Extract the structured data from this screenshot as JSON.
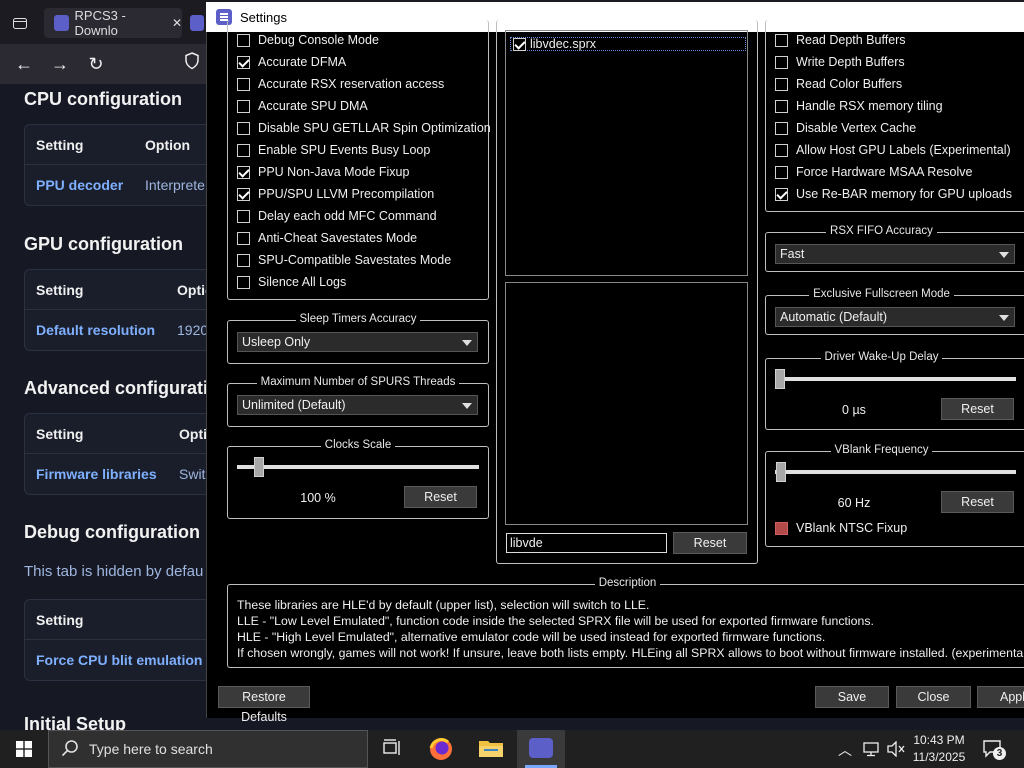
{
  "browser": {
    "tab_title": "RPCS3 - Downlo",
    "close_glyph": "✕"
  },
  "page": {
    "cpu_title": "CPU configuration",
    "cpu_header_setting": "Setting",
    "cpu_header_option": "Option",
    "cpu_row_setting": "PPU decoder",
    "cpu_row_option": "Interprete",
    "gpu_title": "GPU configuration",
    "gpu_header_setting": "Setting",
    "gpu_header_option": "Optio",
    "gpu_row_setting": "Default resolution",
    "gpu_row_option": "1920",
    "adv_title": "Advanced configurati",
    "adv_header_setting": "Setting",
    "adv_header_option": "Optio",
    "adv_row_setting": "Firmware libraries",
    "adv_row_option": "Swit",
    "debug_title": "Debug configuration",
    "debug_hidden": "This tab is hidden by defau",
    "debug_header_setting": "Setting",
    "debug_row_setting": "Force CPU blit emulation",
    "initial_title": "Initial Setup"
  },
  "settings": {
    "title": "Settings",
    "left_checkboxes": [
      {
        "label": "Debug Console Mode",
        "checked": false
      },
      {
        "label": "Accurate DFMA",
        "checked": true
      },
      {
        "label": "Accurate RSX reservation access",
        "checked": false
      },
      {
        "label": "Accurate SPU DMA",
        "checked": false
      },
      {
        "label": "Disable SPU GETLLAR Spin Optimization",
        "checked": false
      },
      {
        "label": "Enable SPU Events Busy Loop",
        "checked": false
      },
      {
        "label": "PPU Non-Java Mode Fixup",
        "checked": true
      },
      {
        "label": "PPU/SPU LLVM Precompilation",
        "checked": true
      },
      {
        "label": "Delay each odd MFC Command",
        "checked": false
      },
      {
        "label": "Anti-Cheat Savestates Mode",
        "checked": false
      },
      {
        "label": "SPU-Compatible Savestates Mode",
        "checked": false
      },
      {
        "label": "Silence All Logs",
        "checked": false
      }
    ],
    "sleep_timers": {
      "title": "Sleep Timers Accuracy",
      "value": "Usleep Only"
    },
    "spurs": {
      "title": "Maximum Number of SPURS Threads",
      "value": "Unlimited (Default)"
    },
    "clocks": {
      "title": "Clocks Scale",
      "value": "100 %",
      "level": 0.05,
      "reset": "Reset"
    },
    "libs": {
      "item": "libvdec.sprx",
      "item_checked": true,
      "filter": "libvde",
      "reset": "Reset"
    },
    "right_checkboxes": [
      {
        "label": "Read Depth Buffers",
        "checked": false
      },
      {
        "label": "Write Depth Buffers",
        "checked": false
      },
      {
        "label": "Read Color Buffers",
        "checked": false
      },
      {
        "label": "Handle RSX memory tiling",
        "checked": false
      },
      {
        "label": "Disable Vertex Cache",
        "checked": false
      },
      {
        "label": "Allow Host GPU Labels (Experimental)",
        "checked": false
      },
      {
        "label": "Force Hardware MSAA Resolve",
        "checked": false
      },
      {
        "label": "Use Re-BAR memory for GPU uploads",
        "checked": true
      }
    ],
    "rsx_fifo": {
      "title": "RSX FIFO Accuracy",
      "value": "Fast"
    },
    "fullscreen": {
      "title": "Exclusive Fullscreen Mode",
      "value": "Automatic (Default)"
    },
    "wakeup": {
      "title": "Driver Wake-Up Delay",
      "value": "0 µs",
      "level": 0.0,
      "reset": "Reset"
    },
    "vblank": {
      "title": "VBlank Frequency",
      "value": "60 Hz",
      "level": 0.0,
      "reset": "Reset",
      "ntsc_label": "VBlank NTSC Fixup"
    },
    "description": {
      "title": "Description",
      "line1": "These libraries are HLE'd by default (upper list), selection will switch to LLE.",
      "line2": "LLE - \"Low Level Emulated\", function code inside the selected SPRX file will be used for exported firmware functions.",
      "line3": "HLE - \"High Level Emulated\", alternative emulator code will be used instead for exported firmware functions.",
      "line4": "If chosen wrongly, games will not work! If unsure, leave both lists empty. HLEing all SPRX allows to boot without firmware installed. (experimental)"
    },
    "buttons": {
      "restore": "Restore Defaults",
      "save": "Save",
      "close": "Close",
      "apply": "Appl"
    }
  },
  "taskbar": {
    "search_placeholder": "Type here to search",
    "time": "10:43 PM",
    "date": "11/3/2025",
    "notifications": "3"
  },
  "colors": {
    "accent": "#5b5fc7",
    "link": "#7fb0ff"
  }
}
